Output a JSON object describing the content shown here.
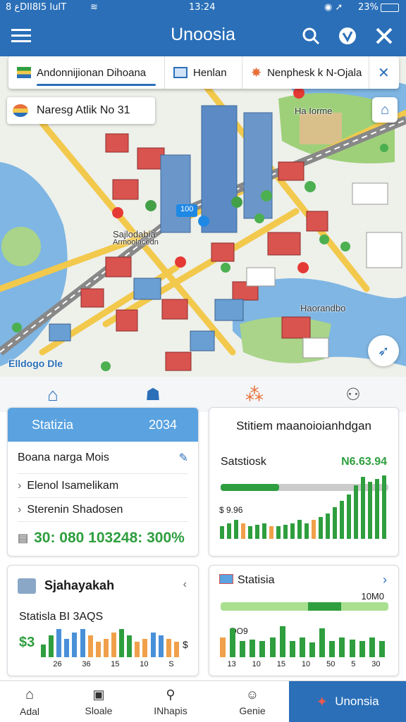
{
  "status": {
    "left": "ع 8DII8I5 IuIT",
    "time": "13:24",
    "battery": "23%"
  },
  "appbar": {
    "title": "Unoosia"
  },
  "tabs": [
    {
      "label": "Andonnijionan Dihoana"
    },
    {
      "label": "Henlan"
    },
    {
      "label": "Nenphesk k N-Ojala"
    }
  ],
  "chip": {
    "label": "Naresg Atlik No 31"
  },
  "map": {
    "labels": [
      "Sajlodabia",
      "Armoolacedn",
      "Ha Iorme",
      "Haorandbo",
      "Elldogo Dle"
    ],
    "badge": "100"
  },
  "cards": {
    "stats": {
      "title": "Statizia",
      "year": "2034",
      "rows": [
        "Boana narga Mois",
        "Elenol Isamelikam",
        "Sterenin Shadosen"
      ],
      "summary": "30: 080 103248: 300%"
    },
    "chart1": {
      "title": "Stitiem maanoioianhdgan",
      "label": "Satstiosk",
      "value": "N6.63.94",
      "sub": "$ 9.96"
    },
    "card3": {
      "title": "Sjahayakah",
      "label": "Statisla BI 3AQS",
      "dollar": "$3",
      "s": "$",
      "ticks": [
        "26",
        "36",
        "15",
        "10",
        "S"
      ]
    },
    "card4": {
      "title": "Statisia",
      "value": "10M0",
      "sub": "DO9",
      "ticks": [
        "13",
        "10",
        "15",
        "10",
        "50",
        "5",
        "30"
      ]
    }
  },
  "nav": [
    {
      "label": "Adal"
    },
    {
      "label": "Sloale"
    },
    {
      "label": "INhapis"
    },
    {
      "label": "Genie"
    },
    {
      "label": "Unonsia"
    }
  ],
  "colors": {
    "primary": "#2a6fb8",
    "green": "#2e9e3e",
    "orange": "#f0a04a",
    "blue": "#4a90d9"
  }
}
